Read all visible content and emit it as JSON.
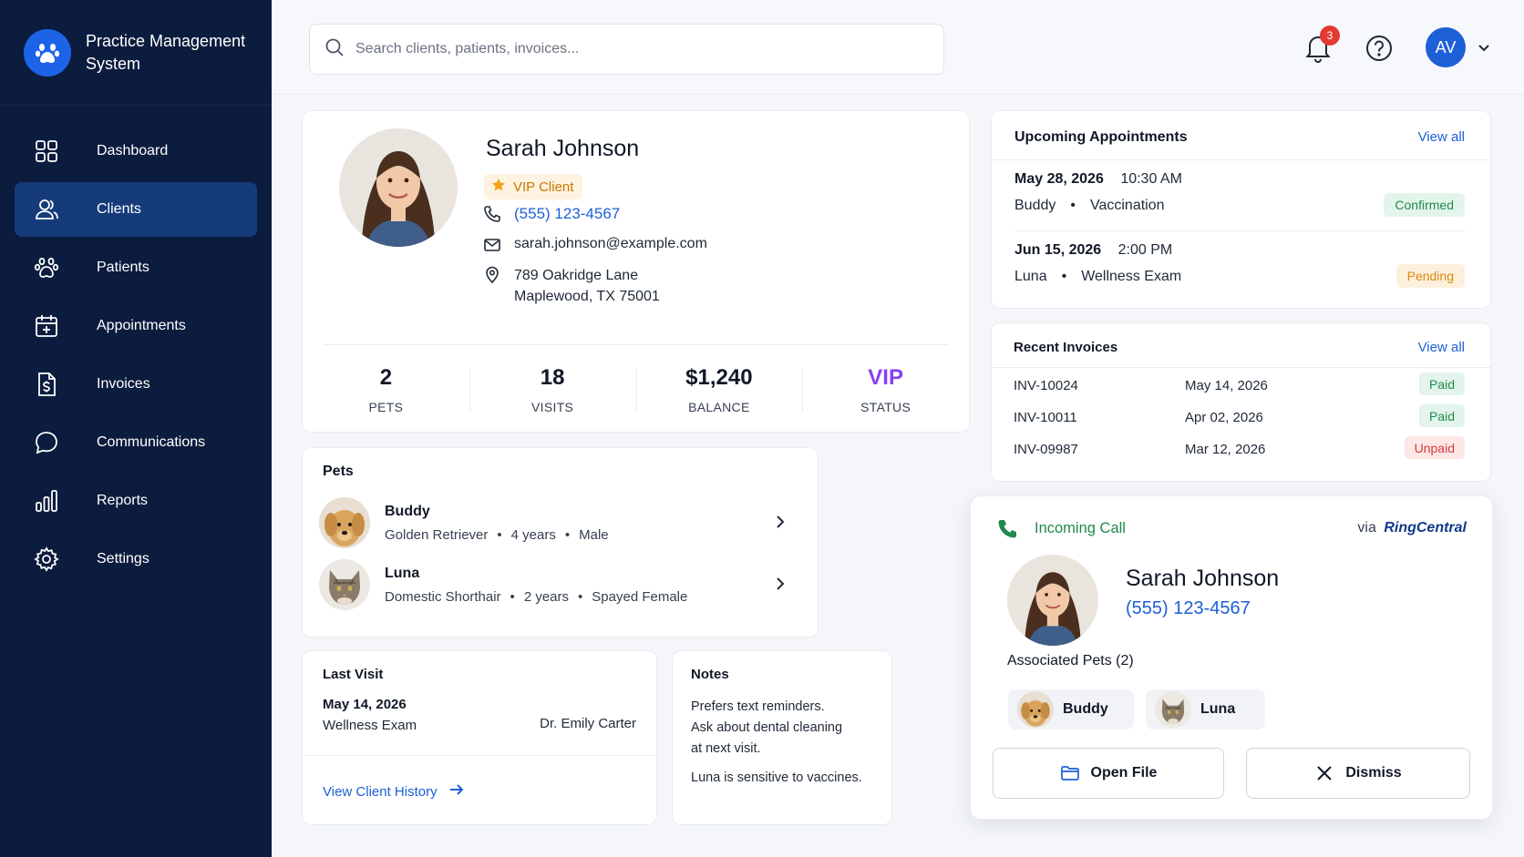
{
  "app": {
    "title": "Practice Management System"
  },
  "sidebar": {
    "items": [
      {
        "label": "Dashboard",
        "icon": "dashboard-grid-icon"
      },
      {
        "label": "Clients",
        "icon": "users-icon",
        "active": true
      },
      {
        "label": "Patients",
        "icon": "paw-icon"
      },
      {
        "label": "Appointments",
        "icon": "calendar-plus-icon"
      },
      {
        "label": "Invoices",
        "icon": "invoice-dollar-icon"
      },
      {
        "label": "Communications",
        "icon": "chat-bubble-icon"
      },
      {
        "label": "Reports",
        "icon": "bar-chart-icon"
      },
      {
        "label": "Settings",
        "icon": "gear-icon"
      }
    ]
  },
  "topbar": {
    "search_placeholder": "Search clients, patients, invoices...",
    "notification_count": "3",
    "user_initials": "AV"
  },
  "client": {
    "name": "Sarah Johnson",
    "tag": "VIP Client",
    "phone": "(555) 123-4567",
    "email": "sarah.johnson@example.com",
    "address_line1": "789 Oakridge Lane",
    "address_line2": "Maplewood, TX 75001",
    "stats": [
      {
        "value": "2",
        "label": "PETS"
      },
      {
        "value": "18",
        "label": "VISITS"
      },
      {
        "value": "$1,240",
        "label": "BALANCE"
      },
      {
        "value": "VIP",
        "label": "STATUS"
      }
    ]
  },
  "pets": {
    "title": "Pets",
    "items": [
      {
        "name": "Buddy",
        "breed": "Golden Retriever",
        "age": "4 years",
        "sex": "Male"
      },
      {
        "name": "Luna",
        "breed": "Domestic Shorthair",
        "age": "2 years",
        "sex": "Spayed Female"
      }
    ]
  },
  "last_visit": {
    "title": "Last Visit",
    "date": "May 14, 2026",
    "type": "Wellness Exam",
    "doctor": "Dr. Emily Carter",
    "link": "View Client History"
  },
  "notes": {
    "title": "Notes",
    "line1": "Prefers text reminders.",
    "line2": "Ask about dental cleaning",
    "line3": "at next visit.",
    "line4": "Luna is sensitive to vaccines."
  },
  "appointments": {
    "title": "Upcoming Appointments",
    "view_all": "View all",
    "items": [
      {
        "date": "May 28, 2026",
        "time": "10:30 AM",
        "pet": "Buddy",
        "type": "Vaccination",
        "status": "Confirmed"
      },
      {
        "date": "Jun 15, 2026",
        "time": "2:00 PM",
        "pet": "Luna",
        "type": "Wellness Exam",
        "status": "Pending"
      }
    ]
  },
  "invoices": {
    "title": "Recent Invoices",
    "view_all": "View all",
    "items": [
      {
        "id": "INV-10024",
        "date": "May 14, 2026",
        "status": "Paid"
      },
      {
        "id": "INV-10011",
        "date": "Apr 02, 2026",
        "status": "Paid"
      },
      {
        "id": "INV-09987",
        "date": "Mar 12, 2026",
        "status": "Unpaid"
      }
    ]
  },
  "call": {
    "title": "Incoming Call",
    "via": "via",
    "provider": "RingCentral",
    "name": "Sarah Johnson",
    "phone": "(555) 123-4567",
    "associated_label": "Associated Pets (2)",
    "pets": [
      "Buddy",
      "Luna"
    ],
    "open_label": "Open File",
    "dismiss_label": "Dismiss"
  },
  "colors": {
    "sidebar_bg": "#0c1c3e",
    "sidebar_active": "#163b7a",
    "accent": "#1d5fd6",
    "vip_purple": "#8a3ff1",
    "call_green": "#1f8a4c"
  }
}
